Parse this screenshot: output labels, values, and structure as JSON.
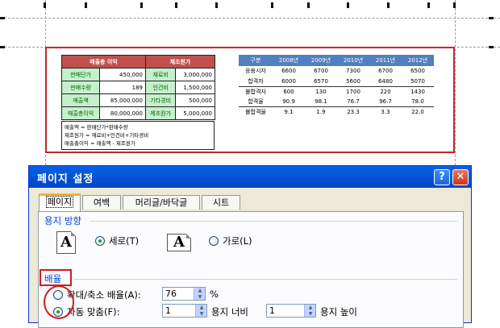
{
  "sheet": {
    "profit_table": {
      "headers": [
        "매출총 이익",
        "제조원가"
      ],
      "rows": [
        {
          "label": "판매단가",
          "value": "450,000",
          "label2": "재료비",
          "value2": "3,000,000"
        },
        {
          "label": "판매수량",
          "value": "189",
          "label2": "인건비",
          "value2": "1,500,000"
        },
        {
          "label": "매출액",
          "value": "85,000,000",
          "label2": "기타경비",
          "value2": "500,000"
        },
        {
          "label": "매출총이익",
          "value": "80,000,000",
          "label2": "제조원가",
          "value2": "5,000,000"
        }
      ]
    },
    "formulas": [
      "매출액 = 판매단가*판매수량",
      "제조원가 = 재료비+인건비+기타경비",
      "매출총이익 = 매출액 - 제조원가"
    ],
    "stats_table": {
      "columns": [
        "구분",
        "2008년",
        "2009년",
        "2010년",
        "2011년",
        "2012년"
      ],
      "rows": [
        [
          "응용시자",
          "6600",
          "6700",
          "7300",
          "6700",
          "6500"
        ],
        [
          "합격자",
          "6000",
          "6570",
          "5600",
          "6480",
          "5070"
        ],
        [
          "불합격자",
          "600",
          "130",
          "1700",
          "220",
          "1430"
        ],
        [
          "합격율",
          "90.9",
          "98.1",
          "76.7",
          "96.7",
          "78.0"
        ],
        [
          "불합격율",
          "9.1",
          "1.9",
          "23.3",
          "3.3",
          "22.0"
        ]
      ]
    }
  },
  "dialog": {
    "title": "페이지 설정",
    "help_glyph": "?",
    "close_glyph": "✕",
    "tabs": [
      "페이지",
      "여백",
      "머리글/바닥글",
      "시트"
    ],
    "orientation": {
      "group_label": "용지 방향",
      "portrait_label": "세로(T)",
      "landscape_label": "가로(L)",
      "icon_letter": "A"
    },
    "scaling": {
      "group_label": "배율",
      "adjust_label": "확대/축소 배율(A):",
      "adjust_value": "76",
      "percent": "%",
      "fit_label": "자동 맞춤(F):",
      "fit_width_value": "1",
      "fit_width_label": "용지 너비",
      "fit_height_value": "1",
      "fit_height_label": "용지 높이"
    }
  }
}
